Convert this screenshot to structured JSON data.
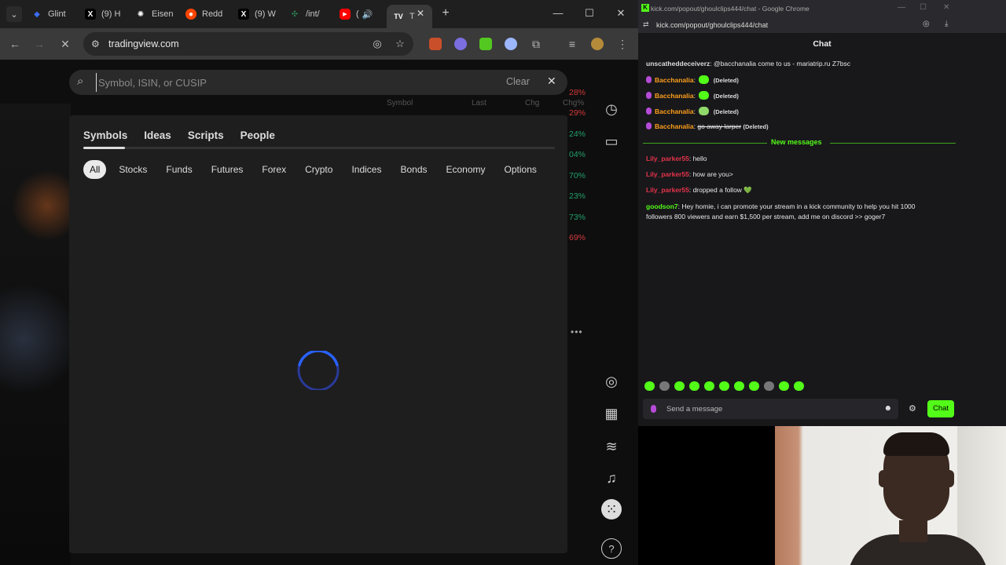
{
  "browser": {
    "tabs": [
      {
        "label": "Glint",
        "icon": "glint-favicon",
        "color": "#3b6ef5"
      },
      {
        "label": "(9) H",
        "icon": "x-favicon",
        "color": "#000000"
      },
      {
        "label": "Eisen",
        "icon": "openai-favicon",
        "color": "#ffffff"
      },
      {
        "label": "Redd",
        "icon": "reddit-favicon",
        "color": "#ff4500"
      },
      {
        "label": "(9) W",
        "icon": "x-favicon",
        "color": "#000000"
      },
      {
        "label": "/int/",
        "icon": "4chan-favicon",
        "color": "#2e8b57"
      },
      {
        "label": "(",
        "icon": "youtube-favicon",
        "color": "#ff0000"
      },
      {
        "label": "T",
        "icon": "tradingview-favicon",
        "color": "#ffffff"
      }
    ],
    "url": "tradingview.com",
    "search_placeholder": "Symbol, ISIN, or CUSIP",
    "clear_label": "Clear",
    "panel_tabs": [
      "Symbols",
      "Ideas",
      "Scripts",
      "People"
    ],
    "filter_chips": [
      "All",
      "Stocks",
      "Funds",
      "Futures",
      "Forex",
      "Crypto",
      "Indices",
      "Bonds",
      "Economy",
      "Options"
    ],
    "behind_header": [
      "Symbol",
      "Last",
      "Chg",
      "Chg%"
    ],
    "behind_percents": [
      {
        "text": "28%",
        "color": "#d33a3a"
      },
      {
        "text": "29%",
        "color": "#d33a3a"
      },
      {
        "text": "24%",
        "color": "#22a06b"
      },
      {
        "text": "04%",
        "color": "#22a06b"
      },
      {
        "text": "70%",
        "color": "#22a06b"
      },
      {
        "text": "23%",
        "color": "#22a06b"
      },
      {
        "text": "73%",
        "color": "#22a06b"
      },
      {
        "text": "69%",
        "color": "#d33a3a"
      }
    ],
    "more_dots": "•••"
  },
  "chat_window": {
    "title": "kick.com/popout/ghoulclips444/chat - Google Chrome",
    "url": "kick.com/popout/ghoulclips444/chat",
    "header": "Chat",
    "messages": [
      {
        "user": "unscatheddeceiverz",
        "user_color": "#dddddd",
        "text": "@bacchanalia come to us - mariatrip.ru Z7bsc"
      },
      {
        "user": "Bacchanalia",
        "user_color": "#ff9f1a",
        "text": "(Deleted)"
      },
      {
        "user": "Bacchanalia",
        "user_color": "#ff9f1a",
        "text": "(Deleted)"
      },
      {
        "user": "Bacchanalia",
        "user_color": "#ff9f1a",
        "text": "(Deleted)"
      },
      {
        "user": "Bacchanalia",
        "user_color": "#ff9f1a",
        "text": "go away larper",
        "suffix": "(Deleted)"
      },
      {
        "user": "Lily_parker55",
        "user_color": "#e6334a",
        "text": "hello"
      },
      {
        "user": "Lily_parker55",
        "user_color": "#e6334a",
        "text": "how are you>"
      },
      {
        "user": "Lily_parker55",
        "user_color": "#e6334a",
        "text": "dropped a follow 💚"
      },
      {
        "user": "goodson7",
        "user_color": "#53fc18",
        "text": "Hey homie, i can promote your stream in a kick community to help you hit 1000",
        "text2": "followers 800 viewers and earn $1,500 per stream, add me on discord >> goger7"
      }
    ],
    "new_messages_label": "New messages",
    "input_placeholder": "Send a message",
    "send_label": "Chat",
    "accent": "#53fc18"
  }
}
